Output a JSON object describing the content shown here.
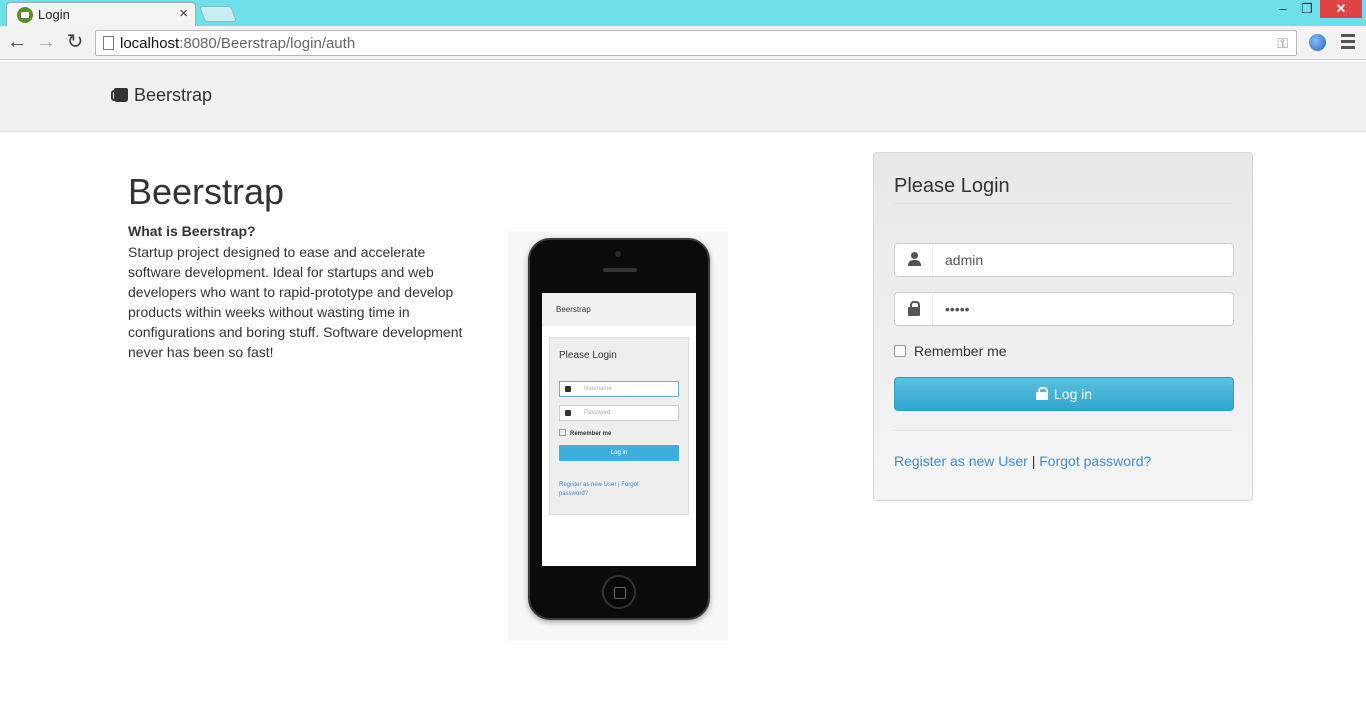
{
  "browser": {
    "tab_title": "Login",
    "tab_close": "×",
    "window_min": "–",
    "window_max": "❐",
    "window_close": "✕",
    "url_host": "localhost",
    "url_rest": ":8080/Beerstrap/login/auth",
    "nav_back": "←",
    "nav_forward": "→",
    "nav_reload": "↻"
  },
  "navbar": {
    "brand": "Beerstrap"
  },
  "hero": {
    "title": "Beerstrap",
    "subtitle": "What is Beerstrap?",
    "description": "Startup project designed to ease and accelerate software development. Ideal for startups and web developers who want to rapid-prototype and develop products within weeks without wasting time in configurations and boring stuff. Software development never has been so fast!"
  },
  "phone_screen": {
    "brand": "Beerstrap",
    "title": "Please Login",
    "username_placeholder": "Username",
    "password_placeholder": "Password",
    "remember": "Remember me",
    "button": "Log in",
    "links": "Register as new User | Forgot password?"
  },
  "login": {
    "title": "Please Login",
    "username_value": "admin",
    "password_value": "•••••",
    "remember_label": "Remember me",
    "button_label": "Log in",
    "register_link": "Register as new User",
    "separator": " | ",
    "forgot_link": "Forgot password?"
  }
}
